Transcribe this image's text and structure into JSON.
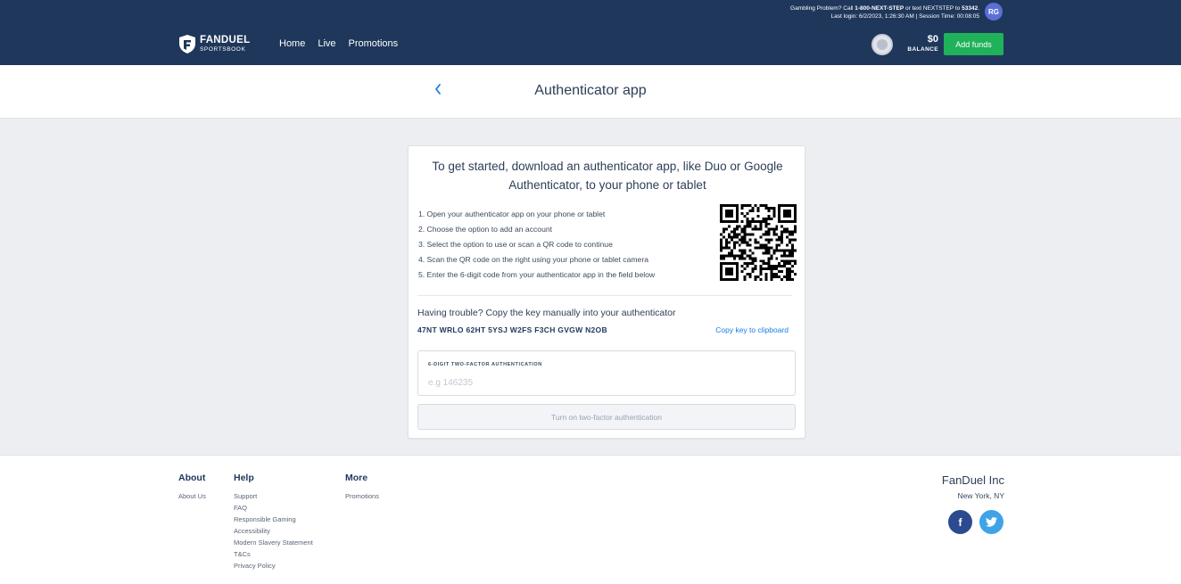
{
  "header": {
    "gambling_prefix": "Gambling Problem? Call ",
    "gambling_phone": "1-800-NEXT-STEP",
    "gambling_mid": " or text NEXTSTEP to ",
    "gambling_code": "53342",
    "gambling_suffix": ".",
    "session_info": "Last login: 6/2/2023, 1:26:30 AM | Session Time: 00:08:05",
    "user_initials": "RG",
    "logo_main": "FANDUEL",
    "logo_sub": "SPORTSBOOK",
    "nav": [
      {
        "label": "Home"
      },
      {
        "label": "Live"
      },
      {
        "label": "Promotions"
      }
    ],
    "balance_amount": "$0",
    "balance_label": "BALANCE",
    "add_funds_label": "Add funds"
  },
  "page": {
    "title": "Authenticator app",
    "back_icon": "chevron-left-icon"
  },
  "card": {
    "intro": "To get started, download an authenticator app, like Duo or Google Authenticator, to your phone or tablet",
    "steps": [
      "1. Open your authenticator app on your phone or tablet",
      "2. Choose the option to add an account",
      "3. Select the option to use or scan a QR code to continue",
      "4. Scan the QR code on the right using your phone or tablet camera",
      "5. Enter the 6-digit code from your authenticator app in the field below"
    ],
    "trouble_text": "Having trouble? Copy the key manually into your authenticator",
    "secret_key": "47NT WRLO 62HT 5YSJ W2FS F3CH GVGW N2OB",
    "copy_link": "Copy key to clipboard",
    "input_label": "6-DIGIT TWO-FACTOR AUTHENTICATION",
    "input_value": "",
    "input_placeholder": "e.g 146235",
    "enable_button": "Turn on two-factor authentication"
  },
  "footer": {
    "about": {
      "title": "About",
      "links": [
        "About Us"
      ]
    },
    "help": {
      "title": "Help",
      "links": [
        "Support",
        "FAQ",
        "Responsible Gaming",
        "Accessibility",
        "Modern Slavery Statement",
        "T&Cs",
        "Privacy Policy"
      ]
    },
    "more": {
      "title": "More",
      "links": [
        "Promotions"
      ]
    },
    "company_name": "FanDuel Inc",
    "company_location": "New York, NY",
    "social": [
      {
        "icon": "facebook-icon",
        "glyph": "f"
      },
      {
        "icon": "twitter-icon",
        "glyph": "t"
      }
    ]
  },
  "colors": {
    "header_bg": "#1f375b",
    "accent_blue": "#1a7de0",
    "add_funds_green": "#1fb25a",
    "page_bg": "#eceef2"
  }
}
